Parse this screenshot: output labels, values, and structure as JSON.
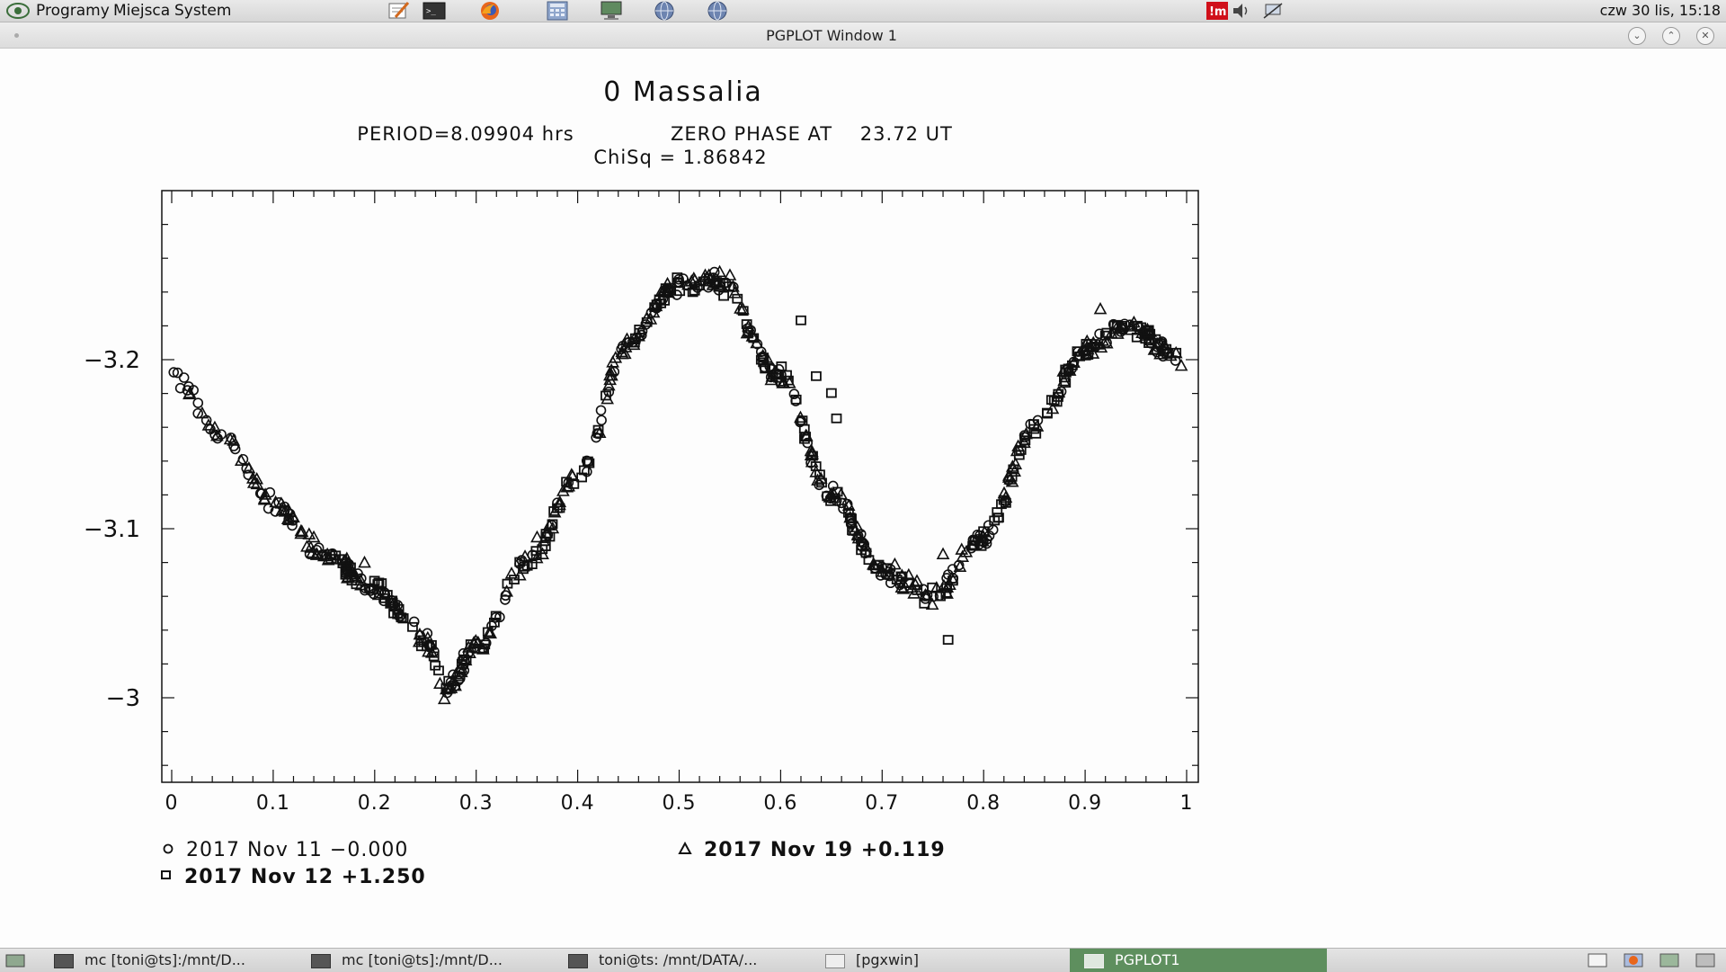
{
  "top_panel": {
    "menu": [
      "Programy",
      "Miejsca",
      "System"
    ],
    "clock": "czw 30 lis, 15:18",
    "launchers": [
      "text-editor-icon",
      "terminal-icon",
      "firefox-icon",
      "calculator-icon",
      "monitor-icon",
      "network-globe-icon",
      "network-globe-icon"
    ],
    "tray": [
      "im-status-icon",
      "volume-icon",
      "network-icon"
    ]
  },
  "window": {
    "title": "PGPLOT Window 1"
  },
  "plot": {
    "title": "0 Massalia",
    "line1_left": "PERIOD=8.09904 hrs",
    "line1_right": "ZERO PHASE AT    23.72 UT",
    "line2": "ChiSq = 1.86842",
    "legend": {
      "nov11": "2017 Nov 11 −0.000",
      "nov19": "2017 Nov 19 +0.119",
      "nov12": "2017 Nov 12 +1.250"
    }
  },
  "chart_data": {
    "type": "scatter",
    "title": "0 Massalia",
    "xlim": [
      0,
      1
    ],
    "ylim": [
      -2.95,
      -3.3
    ],
    "y_inverted": true,
    "x_ticks": [
      "0",
      "0.1",
      "0.2",
      "0.3",
      "0.4",
      "0.5",
      "0.6",
      "0.7",
      "0.8",
      "0.9",
      "1"
    ],
    "y_ticks": [
      {
        "value": -3.2,
        "label": "−3.2"
      },
      {
        "value": -3.1,
        "label": "−3.1"
      },
      {
        "value": -3.0,
        "label": "−3"
      }
    ],
    "curve_phase": [
      0,
      0.05,
      0.1,
      0.15,
      0.2,
      0.25,
      0.27,
      0.3,
      0.35,
      0.4,
      0.45,
      0.5,
      0.54,
      0.6,
      0.65,
      0.7,
      0.75,
      0.8,
      0.85,
      0.9,
      0.94,
      1.0
    ],
    "curve_mag": [
      -3.19,
      -3.155,
      -3.115,
      -3.085,
      -3.065,
      -3.035,
      -3.005,
      -3.03,
      -3.08,
      -3.13,
      -3.21,
      -3.245,
      -3.245,
      -3.19,
      -3.12,
      -3.075,
      -3.06,
      -3.095,
      -3.16,
      -3.205,
      -3.22,
      -3.2
    ],
    "series": [
      {
        "name": "2017 Nov 11 −0.000",
        "marker": "circle",
        "x_range": [
          0,
          1
        ]
      },
      {
        "name": "2017 Nov 19 +0.119",
        "marker": "triangle",
        "x_range": [
          0,
          1
        ]
      },
      {
        "name": "2017 Nov 12 +1.250",
        "marker": "square",
        "x_range": [
          0.15,
          1
        ]
      }
    ],
    "outliers": {
      "square": [
        [
          0.62,
          -3.223
        ],
        [
          0.65,
          -3.18
        ],
        [
          0.765,
          -3.034
        ],
        [
          0.655,
          -3.165
        ],
        [
          0.635,
          -3.19
        ]
      ],
      "triangle": [
        [
          0.14,
          -3.095
        ],
        [
          0.19,
          -3.08
        ],
        [
          0.36,
          -3.095
        ],
        [
          0.915,
          -3.23
        ],
        [
          0.76,
          -3.085
        ],
        [
          0.55,
          -3.25
        ]
      ]
    }
  },
  "bottom_panel": {
    "tasks": [
      "mc [toni@ts]:/mnt/D...",
      "mc [toni@ts]:/mnt/D...",
      "toni@ts: /mnt/DATA/...",
      "[pgxwin]",
      "PGPLOT1"
    ]
  }
}
